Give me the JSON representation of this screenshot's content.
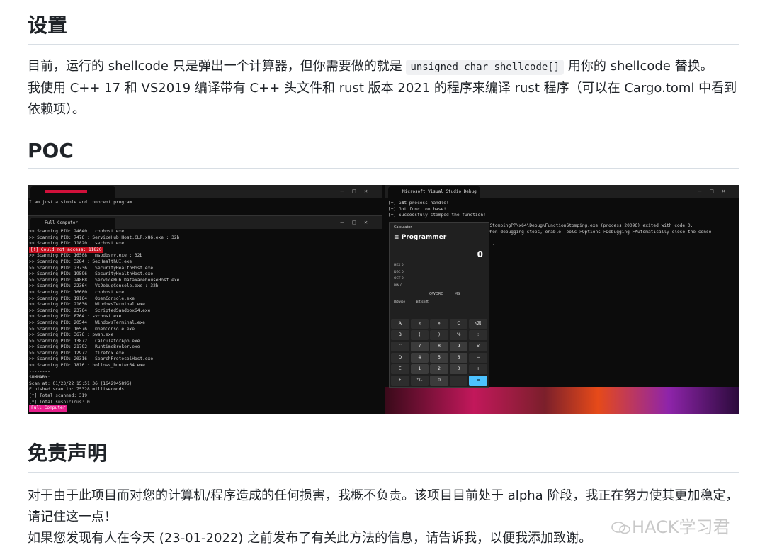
{
  "sections": {
    "setup": {
      "heading": "设置",
      "line1_pre": "目前，运行的 shellcode 只是弹出一个计算器，但你需要做的就是 ",
      "code": "unsigned char shellcode[]",
      "line1_post": " 用你的 shellcode 替换。",
      "line2": "我使用 C++ 17 和 VS2019 编译带有 C++ 头文件和 rust 版本 2021 的程序来编译 rust 程序（可以在 Cargo.toml 中看到依赖项）。"
    },
    "poc": {
      "heading": "POC"
    },
    "disclaimer": {
      "heading": "免责声明",
      "line1": "对于由于此项目而对您的计算机/程序造成的任何损害，我概不负责。该项目目前处于 alpha 阶段，我正在努力使其更加稳定，请记住这一点！",
      "line2": "如果您发现有人在今天 (23-01-2022) 之前发布了有关此方法的信息，请告诉我，以便我添加致谢。"
    }
  },
  "screenshot": {
    "term_top_text": "I am just a simple and innocent program",
    "tab_full_computer": "Full Computer",
    "tab_vs_debug": "Microsoft Visual Studio Debug C",
    "scan_lines": [
      ">> Scanning PID: 24040 : conhost.exe",
      ">> Scanning PID: 7476 : ServiceHub.Host.CLR.x86.exe : 32b",
      ">> Scanning PID: 11820 : svchost.exe",
      "[!] Could not access: 11820",
      ">> Scanning PID: 16508 : mspdbsrv.exe : 32b",
      ">> Scanning PID: 3284 : SecHealthUI.exe",
      ">> Scanning PID: 23736 : SecurityHealthHost.exe",
      ">> Scanning PID: 19596 : SecurityHealthHost.exe",
      ">> Scanning PID: 24868 : ServiceHub.DataWarehouseHost.exe",
      ">> Scanning PID: 22364 : VsDebugConsole.exe : 32b",
      ">> Scanning PID: 16600 : conhost.exe",
      ">> Scanning PID: 19164 : OpenConsole.exe",
      ">> Scanning PID: 21036 : WindowsTerminal.exe",
      ">> Scanning PID: 23764 : ScriptedSandbox64.exe",
      ">> Scanning PID: 8764 : svchost.exe",
      ">> Scanning PID: 20544 : WindowsTerminal.exe",
      ">> Scanning PID: 16576 : OpenConsole.exe",
      ">> Scanning PID: 3676 : pwsh.exe",
      ">> Scanning PID: 13872 : CalculatorApp.exe",
      ">> Scanning PID: 21792 : RuntimeBroker.exe",
      ">> Scanning PID: 12972 : firefox.exe",
      ">> Scanning PID: 20316 : SearchProtocolHost.exe",
      ">> Scanning PID: 1816 : hollows_hunter64.exe",
      "--------",
      "SUMMARY:",
      "Scan at: 01/23/22 15:51:36 (1642945896)",
      "Finished scan in: 75328 milliseconds",
      "[*] Total scanned: 319",
      "[*] Total suspicious: 0"
    ],
    "prompt_label": "Full Computer",
    "vs_lines": [
      "[+] Got process handle!",
      "[+] Got function base!",
      "[+] Successfuly stomped the function!"
    ],
    "vs_right_lines": [
      "onStompingPP\\x64\\Debug\\FunctionStomping.exe (process 20096) exited with code 0.",
      " when debugging stops, enable Tools->Options->Debugging->Automatically close the conso",
      "",
      " . . ."
    ],
    "calculator": {
      "title": "Calculator",
      "mode": "Programmer",
      "display": "0",
      "bases": [
        "HEX 0",
        "DEC 0",
        "OCT 0",
        "BIN 0"
      ],
      "word": "QWORD",
      "ms": "MS",
      "bitwise": "Bitwise",
      "bitshift": "Bit shift",
      "keys": [
        "A",
        "«",
        "»",
        "C",
        "⌫",
        "B",
        "(",
        ")",
        "%",
        "÷",
        "C",
        "7",
        "8",
        "9",
        "×",
        "D",
        "4",
        "5",
        "6",
        "−",
        "E",
        "1",
        "2",
        "3",
        "+",
        "F",
        "⁺/₋",
        "0",
        ".",
        "="
      ]
    }
  },
  "watermark": "HACK学习君"
}
